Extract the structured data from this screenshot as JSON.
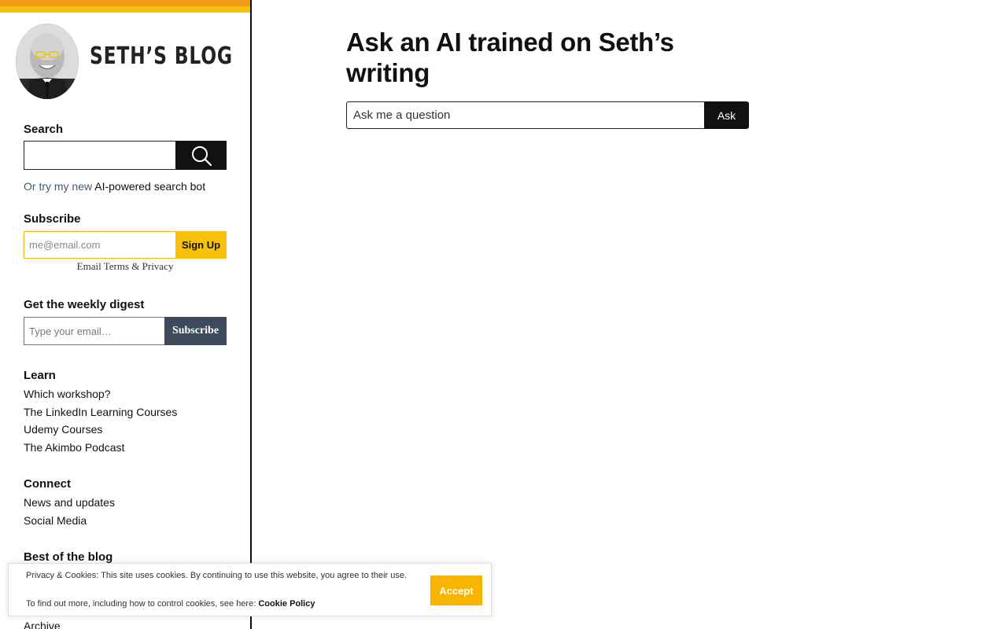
{
  "brand": {
    "name": "SETH’S BLOG"
  },
  "search": {
    "label": "Search",
    "button_icon": "search-icon"
  },
  "ai_line": {
    "prefix": "Or try my new",
    "link": "AI-powered search bot"
  },
  "subscribe": {
    "label": "Subscribe",
    "placeholder": "me@email.com",
    "button": "Sign Up",
    "terms": "Email Terms",
    "amp": "&",
    "privacy": "Privacy"
  },
  "digest": {
    "label": "Get the weekly digest",
    "placeholder": "Type your email…",
    "button": "Subscribe"
  },
  "learn": {
    "label": "Learn",
    "items": [
      "Which workshop?",
      "The LinkedIn Learning Courses",
      "Udemy Courses",
      "The Akimbo Podcast"
    ]
  },
  "connect": {
    "label": "Connect",
    "items": [
      "News and updates",
      "Social Media"
    ]
  },
  "best": {
    "label": "Best of the blog",
    "items": [
      "Archive"
    ]
  },
  "main": {
    "title": "Ask an AI trained on Seth’s writing",
    "placeholder": "Ask me a question",
    "button": "Ask"
  },
  "cookie": {
    "text1": "Privacy & Cookies: This site uses cookies. By continuing to use this website, you agree to their use.",
    "text2": "To find out more, including how to control cookies, see here:",
    "link": "Cookie Policy",
    "accept": "Accept"
  },
  "colors": {
    "stripe_top": "#f29a1a",
    "stripe_bottom": "#f7c20c",
    "accept": "#f7b500",
    "digest_button": "#3d4a5a"
  }
}
